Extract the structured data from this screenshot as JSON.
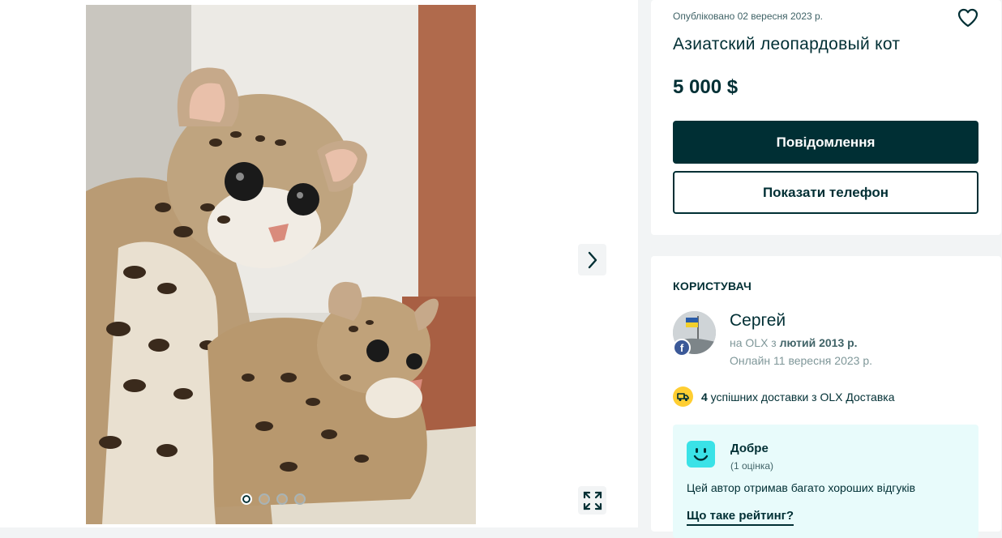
{
  "gallery": {
    "photo_alt": "leopard-cats-photo",
    "dots_total": 4,
    "dots_active": 1,
    "next_icon": "chevron-right-icon",
    "fullscreen_icon": "expand-icon"
  },
  "offer": {
    "posted": "Опубліковано 02 вересня 2023 р.",
    "title": "Азиатский леопардовый кот",
    "price": "5 000 $",
    "message_button": "Повідомлення",
    "phone_button": "Показати телефон",
    "favorite_icon": "heart-icon"
  },
  "user": {
    "section_title": "КОРИСТУВАЧ",
    "name": "Сергей",
    "since_prefix": "на OLX з ",
    "since_date": "лютий 2013 р.",
    "online": "Онлайн 11 вересня 2023 р.",
    "fb_letter": "f",
    "delivery_count": "4",
    "delivery_text": " успішних доставки з OLX Доставка",
    "rating": {
      "label": "Добре",
      "count": "(1 оцінка)",
      "description": "Цей автор отримав багато хороших відгуків",
      "link": "Що таке рейтинг?"
    }
  },
  "colors": {
    "brand_dark": "#002f34",
    "page_bg": "#f2f4f5",
    "rating_bg": "#e8fbfb",
    "smile": "#3ae2e7",
    "delivery_badge": "#ffce32"
  }
}
